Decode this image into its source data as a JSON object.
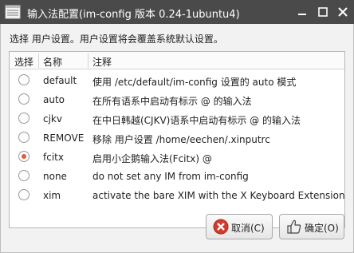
{
  "window": {
    "title": "输入法配置(im-config 版本 0.24-1ubuntu4)",
    "app_icon": "window-list-icon",
    "minimize_icon": "minimize-icon",
    "maximize_icon": "maximize-icon",
    "close_icon": "close-icon"
  },
  "instruction": "选择 用户设置。用户设置将会覆盖系统默认设置。",
  "table": {
    "columns": [
      "选择",
      "名称",
      "注释"
    ],
    "rows": [
      {
        "name": "default",
        "description": "使用 /etc/default/im-config 设置的 auto 模式",
        "selected": false
      },
      {
        "name": "auto",
        "description": "在所有语系中启动有标示 @ 的输入法",
        "selected": false
      },
      {
        "name": "cjkv",
        "description": "在中日韩越(CJKV)语系中启动有标示 @ 的输入法",
        "selected": false
      },
      {
        "name": "REMOVE",
        "description": "移除 用户设置 /home/eechen/.xinputrc",
        "selected": false
      },
      {
        "name": "fcitx",
        "description": "启用小企鹅输入法(Fcitx) @",
        "selected": true
      },
      {
        "name": "none",
        "description": "do not set any IM from im-config",
        "selected": false
      },
      {
        "name": "xim",
        "description": "activate the bare XIM with the X Keyboard Extension",
        "selected": false
      }
    ]
  },
  "buttons": {
    "cancel_label": "取消(C)",
    "cancel_icon": "cancel-icon",
    "ok_label": "确定(O)",
    "ok_icon": "thumbs-up-icon"
  },
  "colors": {
    "titlebar": "#4a4a4a",
    "radio_selected": "#e05a3a",
    "cancel_icon": "#d33b2c"
  }
}
